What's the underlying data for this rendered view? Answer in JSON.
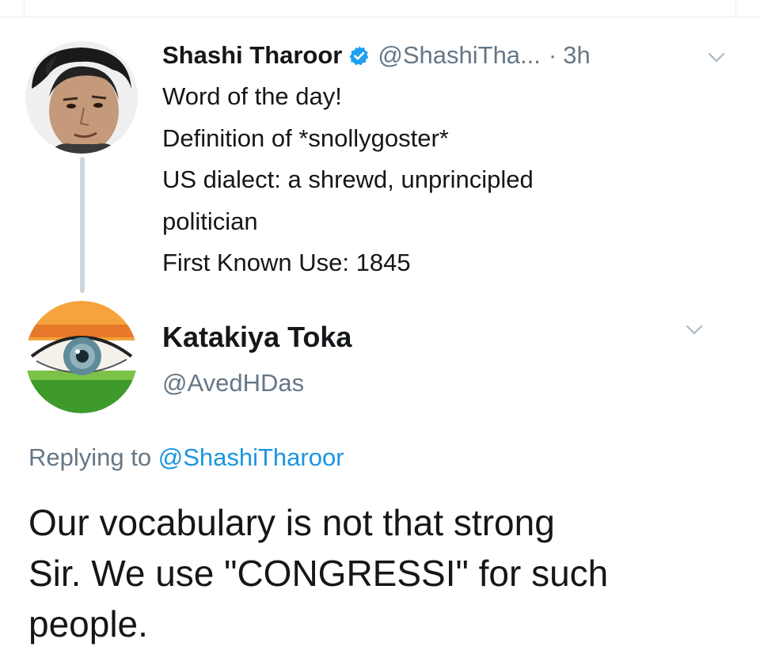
{
  "parent_tweet": {
    "display_name": "Shashi Tharoor",
    "handle": "@ShashiTha...",
    "separator": "·",
    "timestamp": "3h",
    "verified": true,
    "avatar_icon": "person-portrait-icon",
    "lines": [
      "Word of the day!",
      "Definition of *snollygoster*",
      "US dialect: a shrewd, unprincipled",
      "politician",
      "First Known Use: 1845"
    ]
  },
  "reply_tweet": {
    "display_name": "Katakiya Toka",
    "handle": "@AvedHDas",
    "avatar_icon": "tricolor-eye-icon",
    "replying_prefix": "Replying to",
    "replying_mention": "@ShashiTharoor",
    "lines": [
      "Our vocabulary is not that strong",
      "Sir. We use \"CONGRESSI\" for such",
      "people."
    ]
  },
  "colors": {
    "verified_blue": "#1da1f2",
    "link_blue": "#1b95e0",
    "secondary_text": "#657786",
    "thread_line": "#ccd6dd"
  }
}
